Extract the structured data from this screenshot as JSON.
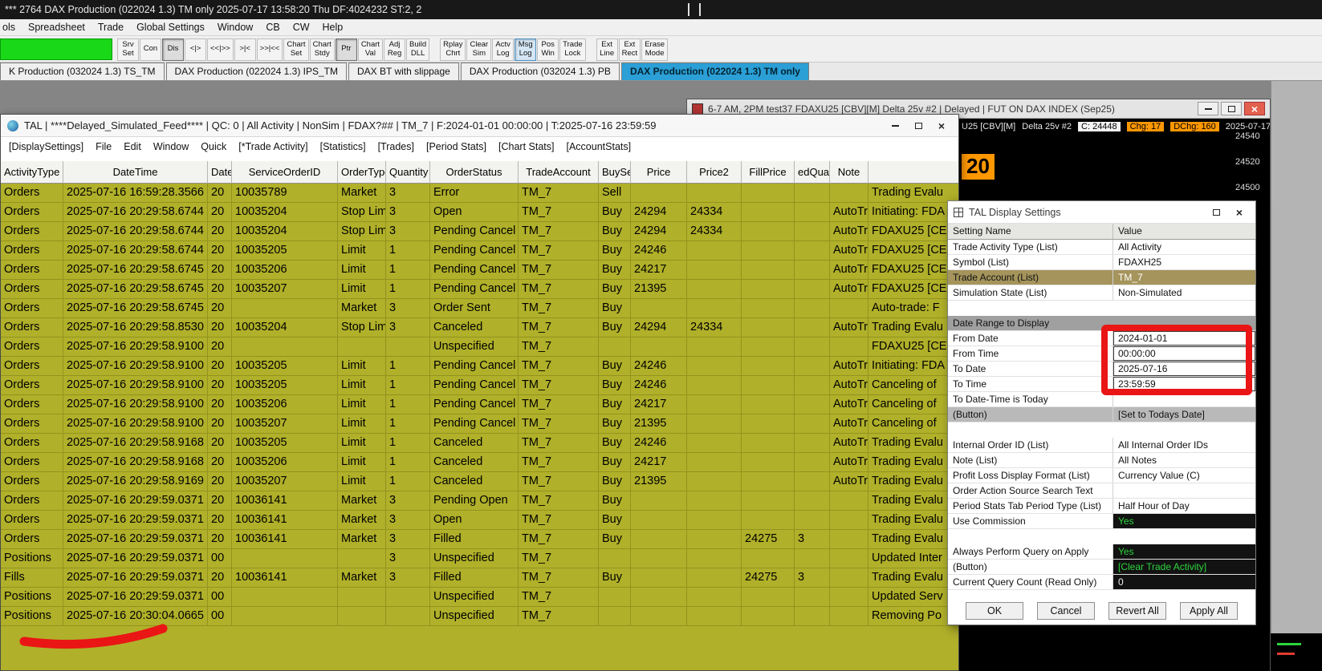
{
  "colors": {
    "accent": "#2b9fd6",
    "table_olive": "#b0b02a",
    "annotation_red": "#ea1515",
    "indicator_green": "#18d818",
    "chart_orange": "#ff9700",
    "positive_green": "#2bd53c"
  },
  "titlebar": {
    "text": "*** 2764 DAX Production (022024 1.3) TM only 2025-07-17  13:58:20 Thu DF:4024232  ST:2, 2"
  },
  "menubar": {
    "items": [
      "ols",
      "Spreadsheet",
      "Trade",
      "Global Settings",
      "Window",
      "CB",
      "CW",
      "Help"
    ]
  },
  "toolbar": {
    "buttons": [
      {
        "lines": [
          "Srv",
          "Set"
        ]
      },
      {
        "lines": [
          "Con"
        ]
      },
      {
        "lines": [
          "Dis"
        ],
        "style": "pressed"
      },
      {
        "lines": [
          "<|>"
        ]
      },
      {
        "lines": [
          "<<|>>"
        ]
      },
      {
        "lines": [
          ">|<"
        ]
      },
      {
        "lines": [
          ">>|<<"
        ]
      },
      {
        "lines": [
          "Chart",
          "Set"
        ]
      },
      {
        "lines": [
          "Chart",
          "Stdy"
        ]
      },
      {
        "lines": [
          "Ptr"
        ],
        "style": "pressed"
      },
      {
        "lines": [
          "Chart",
          "Val"
        ]
      },
      {
        "lines": [
          "Adj",
          "Reg"
        ]
      },
      {
        "lines": [
          "Build",
          "DLL"
        ]
      },
      {
        "gap": true
      },
      {
        "lines": [
          "Rplay",
          "Chrt"
        ]
      },
      {
        "lines": [
          "Clear",
          "Sim"
        ]
      },
      {
        "lines": [
          "Actv",
          "Log"
        ]
      },
      {
        "lines": [
          "Msg",
          "Log"
        ],
        "style": "active"
      },
      {
        "lines": [
          "Pos",
          "Win"
        ]
      },
      {
        "lines": [
          "Trade",
          "Lock"
        ]
      },
      {
        "gap": true
      },
      {
        "lines": [
          "Ext",
          "Line"
        ]
      },
      {
        "lines": [
          "Ext",
          "Rect"
        ]
      },
      {
        "lines": [
          "Erase",
          "Mode"
        ]
      }
    ]
  },
  "tabs": [
    {
      "label": "K Production (032024 1.3) TS_TM",
      "selected": false
    },
    {
      "label": "DAX Production (022024 1.3) IPS_TM",
      "selected": false
    },
    {
      "label": "DAX BT with slippage",
      "selected": false
    },
    {
      "label": "DAX Production (032024 1.3) PB",
      "selected": false
    },
    {
      "label": "DAX Production (022024 1.3) TM only",
      "selected": true
    }
  ],
  "chart_window": {
    "title": "6-7 AM, 2PM test37 FDAXU25 [CBV][M]  Delta 25v #2 | Delayed | FUT ON DAX INDEX (Sep25)",
    "info": {
      "symbol": "U25 [CBV][M]",
      "series": "Delta 25v #2",
      "close_label": "C: 24448",
      "chg_label": "Chg: 17",
      "dchg_label": "DChg: 160",
      "date": "2025-07-17"
    },
    "price_tag": "20",
    "price_scale": [
      "24540",
      "24520",
      "24500"
    ]
  },
  "tal_window": {
    "title": "TAL | ****Delayed_Simulated_Feed**** | QC: 0 | All Activity | NonSim | FDAX?## | TM_7 | F:2024-01-01  00:00:00 | T:2025-07-16  23:59:59",
    "menu": [
      "[DisplaySettings]",
      "File",
      "Edit",
      "Window",
      "Quick",
      "[*Trade Activity]",
      "[Statistics]",
      "[Trades]",
      "[Period Stats]",
      "[Chart Stats]",
      "[AccountStats]"
    ],
    "table": {
      "columns": [
        "ActivityType",
        "DateTime",
        "Date",
        "ServiceOrderID",
        "OrderType",
        "Quantity",
        "OrderStatus",
        "TradeAccount",
        "BuySel",
        "Price",
        "Price2",
        "FillPrice",
        "edQuan",
        "Note",
        ""
      ],
      "rows": [
        [
          "Orders",
          "2025-07-16 16:59:28.3566",
          "20",
          "10035789",
          "Market",
          "3",
          "Error",
          "TM_7",
          "Sell",
          "",
          "",
          "",
          "",
          "",
          "Trading Evalu"
        ],
        [
          "Orders",
          "2025-07-16 20:29:58.6744",
          "20",
          "10035204",
          "Stop Limi",
          "3",
          "Open",
          "TM_7",
          "Buy",
          "24294",
          "24334",
          "",
          "",
          "AutoTra",
          "Initiating: FDA"
        ],
        [
          "Orders",
          "2025-07-16 20:29:58.6744",
          "20",
          "10035204",
          "Stop Limi",
          "3",
          "Pending Cancel",
          "TM_7",
          "Buy",
          "24294",
          "24334",
          "",
          "",
          "AutoTra",
          "FDAXU25 [CE"
        ],
        [
          "Orders",
          "2025-07-16 20:29:58.6744",
          "20",
          "10035205",
          "Limit",
          "1",
          "Pending Cancel",
          "TM_7",
          "Buy",
          "24246",
          "",
          "",
          "",
          "AutoTra",
          "FDAXU25 [CE"
        ],
        [
          "Orders",
          "2025-07-16 20:29:58.6745",
          "20",
          "10035206",
          "Limit",
          "1",
          "Pending Cancel",
          "TM_7",
          "Buy",
          "24217",
          "",
          "",
          "",
          "AutoTra",
          "FDAXU25 [CE"
        ],
        [
          "Orders",
          "2025-07-16 20:29:58.6745",
          "20",
          "10035207",
          "Limit",
          "1",
          "Pending Cancel",
          "TM_7",
          "Buy",
          "21395",
          "",
          "",
          "",
          "AutoTra",
          "FDAXU25 [CE"
        ],
        [
          "Orders",
          "2025-07-16 20:29:58.6745",
          "20",
          "",
          "Market",
          "3",
          "Order Sent",
          "TM_7",
          "Buy",
          "",
          "",
          "",
          "",
          "",
          "Auto-trade: F"
        ],
        [
          "Orders",
          "2025-07-16 20:29:58.8530",
          "20",
          "10035204",
          "Stop Limi",
          "3",
          "Canceled",
          "TM_7",
          "Buy",
          "24294",
          "24334",
          "",
          "",
          "AutoTra",
          "Trading Evalu"
        ],
        [
          "Orders",
          "2025-07-16 20:29:58.9100",
          "20",
          "",
          "",
          "",
          "Unspecified",
          "TM_7",
          "",
          "",
          "",
          "",
          "",
          "",
          "FDAXU25 [CE"
        ],
        [
          "Orders",
          "2025-07-16 20:29:58.9100",
          "20",
          "10035205",
          "Limit",
          "1",
          "Pending Cancel",
          "TM_7",
          "Buy",
          "24246",
          "",
          "",
          "",
          "AutoTra",
          "Initiating: FDA"
        ],
        [
          "Orders",
          "2025-07-16 20:29:58.9100",
          "20",
          "10035205",
          "Limit",
          "1",
          "Pending Cancel",
          "TM_7",
          "Buy",
          "24246",
          "",
          "",
          "",
          "AutoTra",
          "Canceling of"
        ],
        [
          "Orders",
          "2025-07-16 20:29:58.9100",
          "20",
          "10035206",
          "Limit",
          "1",
          "Pending Cancel",
          "TM_7",
          "Buy",
          "24217",
          "",
          "",
          "",
          "AutoTra",
          "Canceling of"
        ],
        [
          "Orders",
          "2025-07-16 20:29:58.9100",
          "20",
          "10035207",
          "Limit",
          "1",
          "Pending Cancel",
          "TM_7",
          "Buy",
          "21395",
          "",
          "",
          "",
          "AutoTra",
          "Canceling of"
        ],
        [
          "Orders",
          "2025-07-16 20:29:58.9168",
          "20",
          "10035205",
          "Limit",
          "1",
          "Canceled",
          "TM_7",
          "Buy",
          "24246",
          "",
          "",
          "",
          "AutoTra",
          "Trading Evalu"
        ],
        [
          "Orders",
          "2025-07-16 20:29:58.9168",
          "20",
          "10035206",
          "Limit",
          "1",
          "Canceled",
          "TM_7",
          "Buy",
          "24217",
          "",
          "",
          "",
          "AutoTra",
          "Trading Evalu"
        ],
        [
          "Orders",
          "2025-07-16 20:29:58.9169",
          "20",
          "10035207",
          "Limit",
          "1",
          "Canceled",
          "TM_7",
          "Buy",
          "21395",
          "",
          "",
          "",
          "AutoTra",
          "Trading Evalu"
        ],
        [
          "Orders",
          "2025-07-16 20:29:59.0371",
          "20",
          "10036141",
          "Market",
          "3",
          "Pending Open",
          "TM_7",
          "Buy",
          "",
          "",
          "",
          "",
          "",
          "Trading Evalu"
        ],
        [
          "Orders",
          "2025-07-16 20:29:59.0371",
          "20",
          "10036141",
          "Market",
          "3",
          "Open",
          "TM_7",
          "Buy",
          "",
          "",
          "",
          "",
          "",
          "Trading Evalu"
        ],
        [
          "Orders",
          "2025-07-16 20:29:59.0371",
          "20",
          "10036141",
          "Market",
          "3",
          "Filled",
          "TM_7",
          "Buy",
          "",
          "",
          "24275",
          "3",
          "",
          "Trading Evalu"
        ],
        [
          "Positions",
          "2025-07-16 20:29:59.0371",
          "00",
          "",
          "",
          "3",
          "Unspecified",
          "TM_7",
          "",
          "",
          "",
          "",
          "",
          "",
          "Updated Inter"
        ],
        [
          "Fills",
          "2025-07-16 20:29:59.0371",
          "20",
          "10036141",
          "Market",
          "3",
          "Filled",
          "TM_7",
          "Buy",
          "",
          "",
          "24275",
          "3",
          "",
          "Trading Evalu"
        ],
        [
          "Positions",
          "2025-07-16 20:29:59.0371",
          "00",
          "",
          "",
          "",
          "Unspecified",
          "TM_7",
          "",
          "",
          "",
          "",
          "",
          "",
          "Updated Serv"
        ],
        [
          "Positions",
          "2025-07-16 20:30:04.0665",
          "00",
          "",
          "",
          "",
          "Unspecified",
          "TM_7",
          "",
          "",
          "",
          "",
          "",
          "",
          "Removing Po"
        ]
      ]
    }
  },
  "settings_dialog": {
    "title": "TAL Display Settings",
    "columns": [
      "Setting Name",
      "Value"
    ],
    "rows": [
      {
        "label": "Trade Activity Type (List)",
        "value": "All Activity",
        "type": "normal"
      },
      {
        "label": "Symbol (List)",
        "value": "FDAXH25",
        "type": "normal"
      },
      {
        "label": "Trade Account (List)",
        "value": "TM_7",
        "type": "selected"
      },
      {
        "label": "Simulation State (List)",
        "value": "Non-Simulated",
        "type": "normal"
      },
      {
        "label": "",
        "value": "",
        "type": "spacer"
      },
      {
        "label": "Date Range to Display",
        "value": "",
        "type": "section"
      },
      {
        "label": "From Date",
        "value": "2024-01-01",
        "type": "dateinput"
      },
      {
        "label": "From Time",
        "value": "00:00:00",
        "type": "dateinput"
      },
      {
        "label": "To Date",
        "value": "2025-07-16",
        "type": "dateinput"
      },
      {
        "label": "To Time",
        "value": "23:59:59",
        "type": "dateinput"
      },
      {
        "label": "To Date-Time is Today",
        "value": "",
        "type": "normal"
      },
      {
        "label": "(Button)",
        "value": "[Set to Todays Date]",
        "type": "buttonrow"
      },
      {
        "label": "",
        "value": "",
        "type": "spacer"
      },
      {
        "label": "Internal Order ID (List)",
        "value": "All Internal Order IDs",
        "type": "normal"
      },
      {
        "label": "Note (List)",
        "value": "All Notes",
        "type": "normal"
      },
      {
        "label": "Profit Loss Display Format (List)",
        "value": "Currency Value (C)",
        "type": "normal"
      },
      {
        "label": "Order Action Source Search Text",
        "value": "",
        "type": "normal"
      },
      {
        "label": "Period Stats Tab Period Type (List)",
        "value": "Half Hour of Day",
        "type": "normal"
      },
      {
        "label": "Use Commission",
        "value": "Yes",
        "type": "darkgreen"
      },
      {
        "label": "",
        "value": "",
        "type": "spacer"
      },
      {
        "label": "Always Perform Query on Apply",
        "value": "Yes",
        "type": "darkgreen"
      },
      {
        "label": "(Button)",
        "value": "[Clear Trade Activity]",
        "type": "darkgreen"
      },
      {
        "label": "Current Query Count (Read Only)",
        "value": "0",
        "type": "darkwhite"
      }
    ],
    "buttons": [
      "OK",
      "Cancel",
      "Revert All",
      "Apply All"
    ]
  }
}
